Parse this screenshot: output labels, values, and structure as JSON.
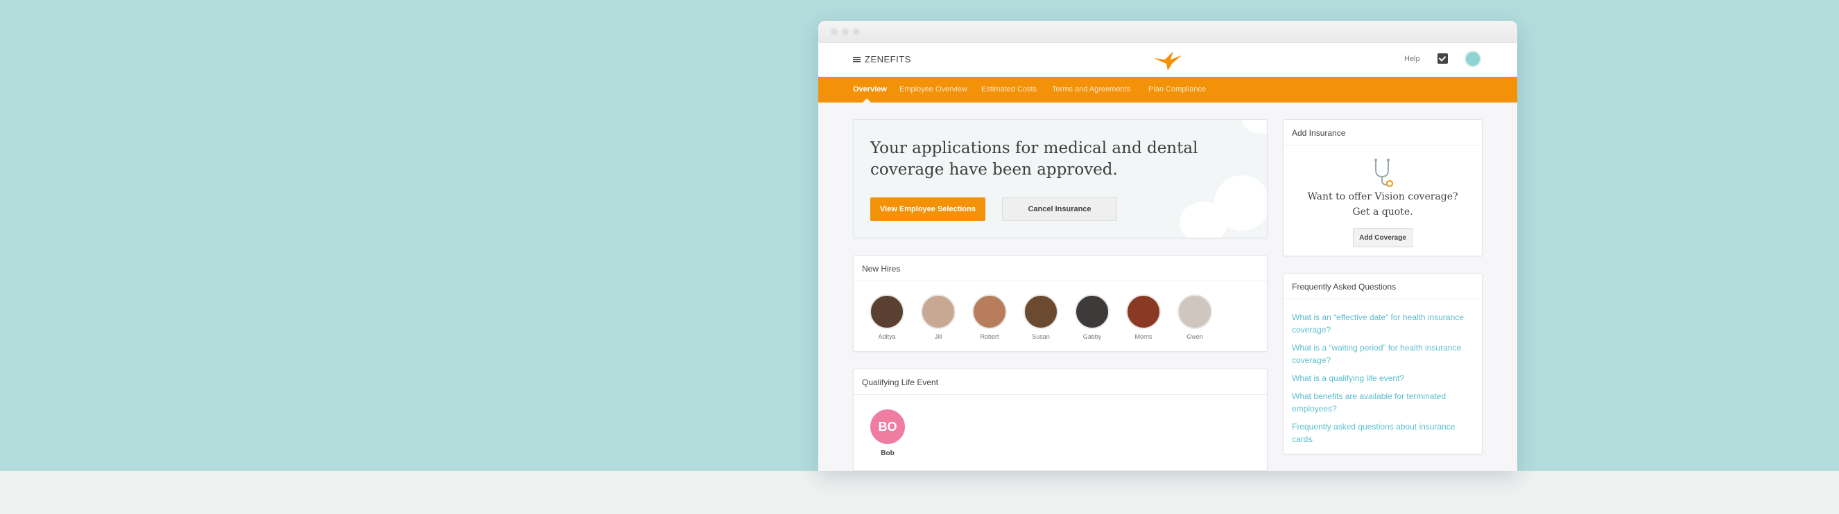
{
  "app": {
    "brand": "ZENEFITS"
  },
  "header": {
    "help_label": "Help"
  },
  "nav": {
    "tabs": [
      {
        "label": "Overview",
        "active": true
      },
      {
        "label": "Employee Overview"
      },
      {
        "label": "Estimated Costs"
      },
      {
        "label": "Terms and Agreements"
      },
      {
        "label": "Plan Compliance"
      }
    ]
  },
  "hero": {
    "title": "Your applications for medical and dental coverage have been approved.",
    "primary_button": "View Employee Selections",
    "secondary_button": "Cancel Insurance"
  },
  "new_hires": {
    "title": "New Hires",
    "people": [
      {
        "name": "Aditya",
        "color": "#5a4030"
      },
      {
        "name": "Jill",
        "color": "#c9a893"
      },
      {
        "name": "Robert",
        "color": "#b77d5d"
      },
      {
        "name": "Susan",
        "color": "#6b4a30"
      },
      {
        "name": "Gabby",
        "color": "#3e3a3a"
      },
      {
        "name": "Morris",
        "color": "#8a3a22"
      },
      {
        "name": "Gwen",
        "color": "#cfc7bf"
      }
    ]
  },
  "qualifying_life_event": {
    "title": "Qualifying Life Event",
    "badge": "BO",
    "name": "Bob",
    "badge_color": "#ef7da2"
  },
  "add_insurance": {
    "title": "Add Insurance",
    "text": "Want to offer Vision coverage? Get a quote.",
    "button": "Add Coverage"
  },
  "faq": {
    "title": "Frequently Asked Questions",
    "links": [
      "What is an “effective date” for health insurance coverage?",
      "What is a “waiting period” for health insurance coverage?",
      "What is a qualifying life event?",
      "What benefits are available for terminated employees?",
      "Frequently asked questions about insurance cards."
    ]
  },
  "colors": {
    "background": "#b3dcdd",
    "accent": "#f39109",
    "link": "#5cbecf"
  },
  "icons": [
    "hamburger-icon",
    "hummingbird-logo",
    "checklist-icon",
    "user-avatar",
    "stethoscope-icon"
  ]
}
